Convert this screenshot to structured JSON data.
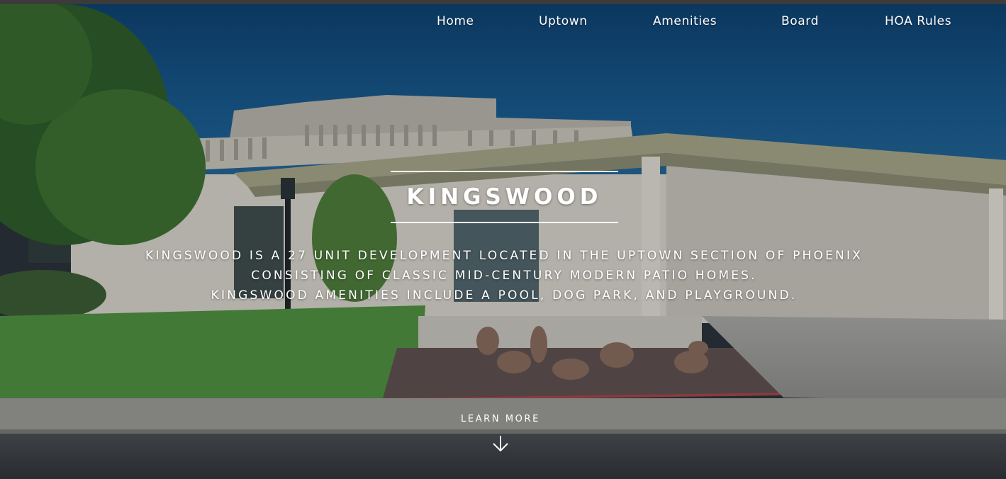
{
  "nav": {
    "items": [
      {
        "label": "Home"
      },
      {
        "label": "Uptown"
      },
      {
        "label": "Amenities"
      },
      {
        "label": "Board"
      },
      {
        "label": "HOA Rules"
      }
    ]
  },
  "hero": {
    "title": "KINGSWOOD",
    "description_lines": [
      "KINGSWOOD IS A 27 UNIT DEVELOPMENT LOCATED IN THE UPTOWN SECTION OF PHOENIX",
      "CONSISTING OF CLASSIC MID-CENTURY MODERN PATIO HOMES.",
      "KINGSWOOD AMENITIES INCLUDE A POOL, DOG PARK, AND PLAYGROUND."
    ],
    "learn_more_label": "LEARN MORE",
    "learn_more_icon": "arrow-down-icon",
    "background_image": "mid-century-patio-home-photo"
  },
  "colors": {
    "sky": "#0f4a7a",
    "text": "#ffffff"
  }
}
